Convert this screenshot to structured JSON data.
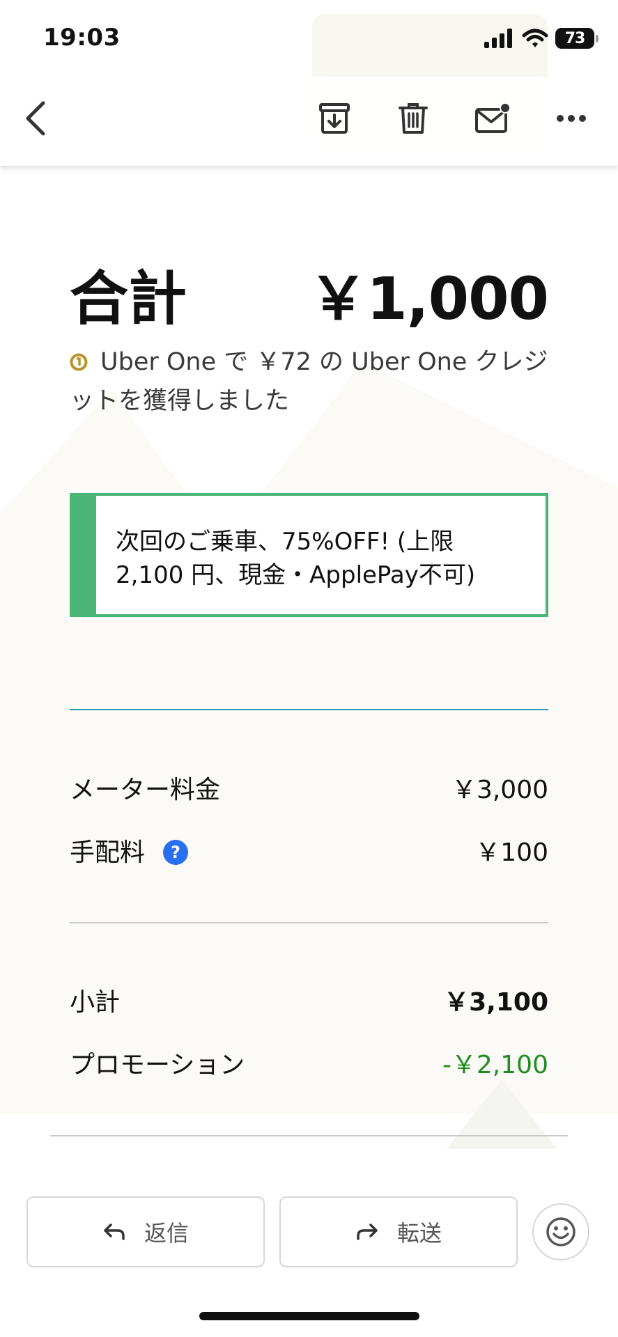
{
  "status_bar": {
    "time": "19:03",
    "battery_level": "73"
  },
  "toolbar": {
    "back_icon": "chevron-left-icon",
    "archive_icon": "archive-icon",
    "delete_icon": "trash-icon",
    "mark_unread_icon": "mail-unread-icon",
    "more_icon": "more-horizontal-icon"
  },
  "receipt": {
    "total_label": "合計",
    "total_value": "￥1,000",
    "credit_text": "Uber One で ￥72 の Uber One クレジットを獲得しました",
    "promo_banner": "次回のご乗車、75%OFF! (上限 2,100 円、現金・ApplePay不可)",
    "fare_items": [
      {
        "label": "メーター料金",
        "value": "￥3,000"
      },
      {
        "label": "手配料",
        "value": "￥100"
      }
    ],
    "help_icon_glyph": "?",
    "subtotal_label": "小計",
    "subtotal_value": "￥3,100",
    "promotion_label": "プロモーション",
    "promotion_value": "-￥2,100"
  },
  "actions": {
    "reply_label": "返信",
    "forward_label": "転送"
  },
  "colors": {
    "accent_green": "#4ab577",
    "promotion_green": "#1e8e1e",
    "help_blue": "#276ef1",
    "divider_teal": "#2a9bb5",
    "credit_gold": "#b8922a"
  }
}
